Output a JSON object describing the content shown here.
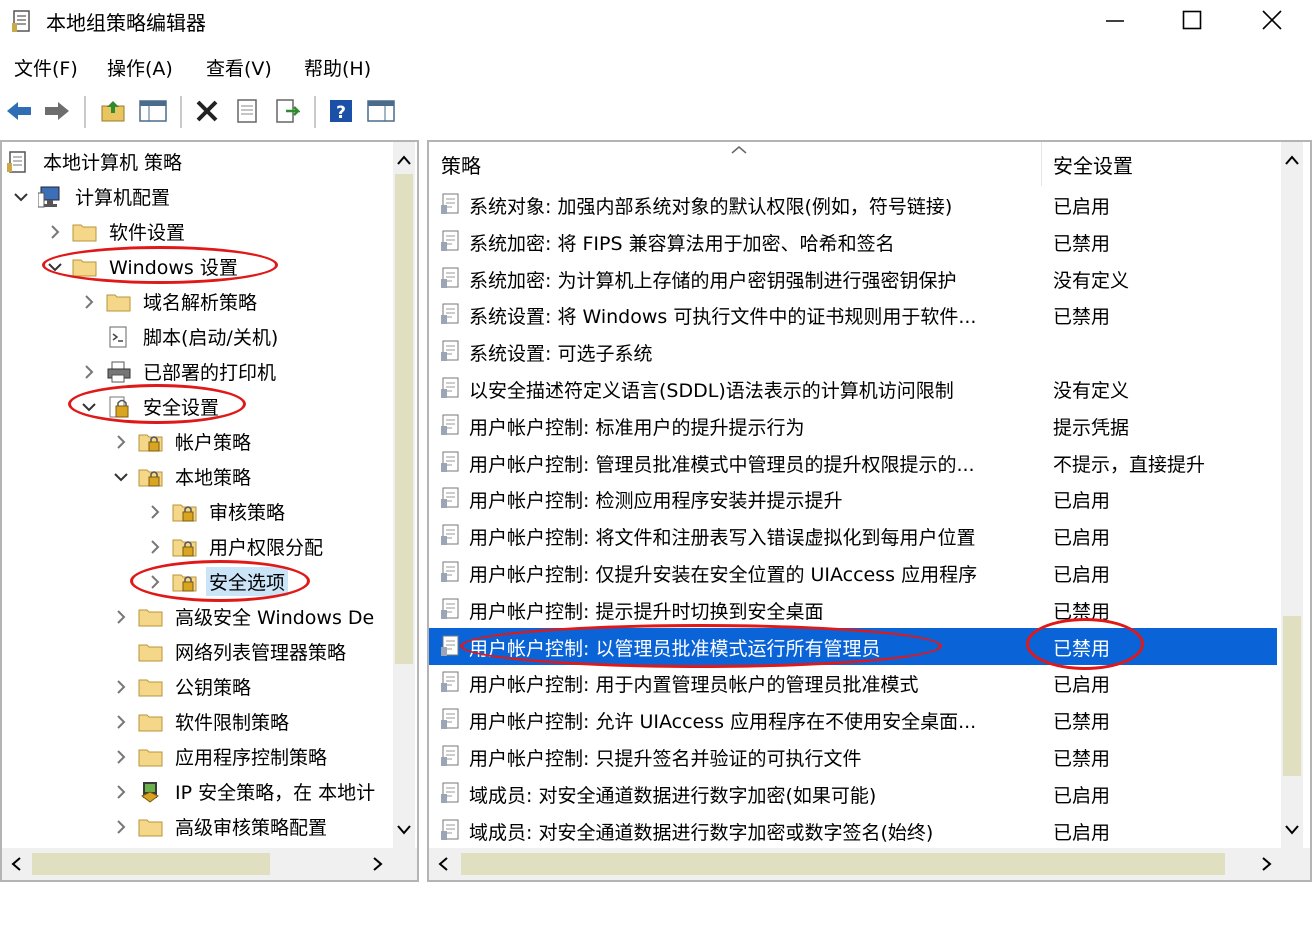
{
  "window": {
    "title": "本地组策略编辑器",
    "icon": "policy-document-icon"
  },
  "menu": [
    {
      "label": "文件(F)"
    },
    {
      "label": "操作(A)"
    },
    {
      "label": "查看(V)"
    },
    {
      "label": "帮助(H)"
    }
  ],
  "toolbar": [
    "back-arrow-icon",
    "forward-arrow-icon",
    "up-folder-icon",
    "show-hide-tree-icon",
    "delete-icon",
    "properties-icon",
    "export-list-icon",
    "help-icon",
    "details-view-icon"
  ],
  "tree": {
    "items": [
      {
        "label": "本地计算机 策略",
        "icon": "policy-document-icon",
        "chevron": "none"
      },
      {
        "label": "计算机配置",
        "icon": "computer-icon",
        "chevron": "expanded"
      },
      {
        "label": "软件设置",
        "icon": "folder-icon",
        "chevron": "collapsed"
      },
      {
        "label": "Windows 设置",
        "icon": "folder-icon",
        "chevron": "expanded"
      },
      {
        "label": "域名解析策略",
        "icon": "folder-icon",
        "chevron": "collapsed"
      },
      {
        "label": "脚本(启动/关机)",
        "icon": "script-icon",
        "chevron": "none"
      },
      {
        "label": "已部署的打印机",
        "icon": "printer-icon",
        "chevron": "collapsed"
      },
      {
        "label": "安全设置",
        "icon": "security-icon",
        "chevron": "expanded"
      },
      {
        "label": "帐户策略",
        "icon": "security-folder-icon",
        "chevron": "collapsed"
      },
      {
        "label": "本地策略",
        "icon": "security-folder-icon",
        "chevron": "expanded"
      },
      {
        "label": "审核策略",
        "icon": "security-folder-icon",
        "chevron": "collapsed"
      },
      {
        "label": "用户权限分配",
        "icon": "security-folder-icon",
        "chevron": "collapsed"
      },
      {
        "label": "安全选项",
        "icon": "security-folder-icon",
        "chevron": "collapsed"
      },
      {
        "label": "高级安全 Windows De",
        "icon": "folder-icon",
        "chevron": "collapsed"
      },
      {
        "label": "网络列表管理器策略",
        "icon": "folder-icon",
        "chevron": "none"
      },
      {
        "label": "公钥策略",
        "icon": "folder-icon",
        "chevron": "collapsed"
      },
      {
        "label": "软件限制策略",
        "icon": "folder-icon",
        "chevron": "collapsed"
      },
      {
        "label": "应用程序控制策略",
        "icon": "folder-icon",
        "chevron": "collapsed"
      },
      {
        "label": "IP 安全策略，在 本地计",
        "icon": "ip-security-icon",
        "chevron": "collapsed"
      },
      {
        "label": "高级审核策略配置",
        "icon": "folder-icon",
        "chevron": "collapsed"
      }
    ],
    "selected_item": "安全选项"
  },
  "list": {
    "headers": {
      "policy": "策略",
      "setting": "安全设置"
    },
    "rows": [
      {
        "policy": "系统对象: 加强内部系统对象的默认权限(例如，符号链接)",
        "setting": "已启用"
      },
      {
        "policy": "系统加密: 将 FIPS 兼容算法用于加密、哈希和签名",
        "setting": "已禁用"
      },
      {
        "policy": "系统加密: 为计算机上存储的用户密钥强制进行强密钥保护",
        "setting": "没有定义"
      },
      {
        "policy": "系统设置: 将 Windows 可执行文件中的证书规则用于软件...",
        "setting": "已禁用"
      },
      {
        "policy": "系统设置: 可选子系统",
        "setting": ""
      },
      {
        "policy": "以安全描述符定义语言(SDDL)语法表示的计算机访问限制",
        "setting": "没有定义"
      },
      {
        "policy": "用户帐户控制: 标准用户的提升提示行为",
        "setting": "提示凭据"
      },
      {
        "policy": "用户帐户控制: 管理员批准模式中管理员的提升权限提示的...",
        "setting": "不提示，直接提升"
      },
      {
        "policy": "用户帐户控制: 检测应用程序安装并提示提升",
        "setting": "已启用"
      },
      {
        "policy": "用户帐户控制: 将文件和注册表写入错误虚拟化到每用户位置",
        "setting": "已启用"
      },
      {
        "policy": "用户帐户控制: 仅提升安装在安全位置的 UIAccess 应用程序",
        "setting": "已启用"
      },
      {
        "policy": "用户帐户控制: 提示提升时切换到安全桌面",
        "setting": "已禁用"
      },
      {
        "policy": "用户帐户控制: 以管理员批准模式运行所有管理员",
        "setting": "已禁用"
      },
      {
        "policy": "用户帐户控制: 用于内置管理员帐户的管理员批准模式",
        "setting": "已启用"
      },
      {
        "policy": "用户帐户控制: 允许 UIAccess 应用程序在不使用安全桌面...",
        "setting": "已禁用"
      },
      {
        "policy": "用户帐户控制: 只提升签名并验证的可执行文件",
        "setting": "已禁用"
      },
      {
        "policy": "域成员: 对安全通道数据进行数字加密(如果可能)",
        "setting": "已启用"
      },
      {
        "policy": "域成员: 对安全通道数据进行数字加密或数字签名(始终)",
        "setting": "已启用"
      }
    ],
    "selected_row": "用户帐户控制: 以管理员批准模式运行所有管理员"
  },
  "colors": {
    "selection": "#0a64d8",
    "annotation": "#e01818",
    "scroll_thumb": "#e0e0c0",
    "folder": "#f5d78a"
  }
}
